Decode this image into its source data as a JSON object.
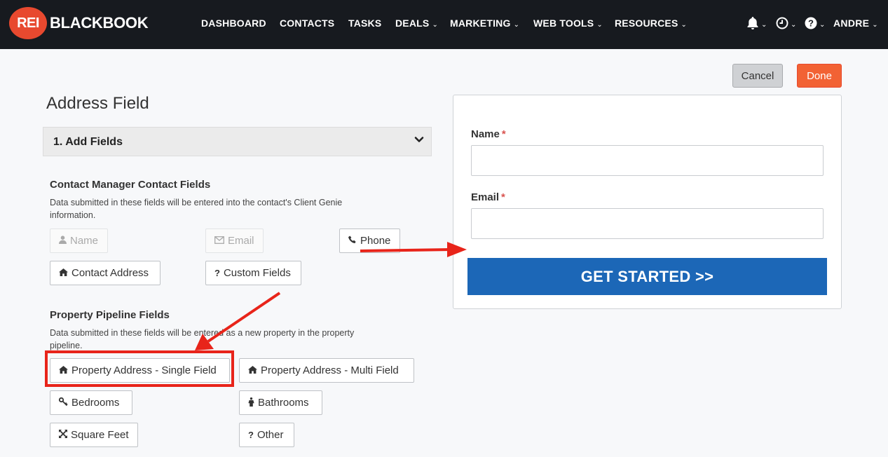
{
  "app": {
    "logo_badge": "REI",
    "logo_text": "BLACKBOOK"
  },
  "nav": {
    "items": [
      {
        "label": "DASHBOARD",
        "has_dropdown": false
      },
      {
        "label": "CONTACTS",
        "has_dropdown": false
      },
      {
        "label": "TASKS",
        "has_dropdown": false
      },
      {
        "label": "DEALS",
        "has_dropdown": true
      },
      {
        "label": "MARKETING",
        "has_dropdown": true
      },
      {
        "label": "WEB TOOLS",
        "has_dropdown": true
      },
      {
        "label": "RESOURCES",
        "has_dropdown": true
      }
    ],
    "icons": [
      "bell-icon",
      "clock-icon",
      "help-icon"
    ],
    "user": "ANDRE"
  },
  "actions": {
    "cancel_label": "Cancel",
    "done_label": "Done"
  },
  "editor": {
    "title": "Address Field",
    "section_label": "1. Add Fields",
    "contact_group": {
      "title": "Contact Manager Contact Fields",
      "description": "Data submitted in these fields will be entered into the contact's Client Genie information.",
      "buttons": [
        {
          "label": "Name",
          "icon": "user-icon",
          "disabled": true
        },
        {
          "label": "Email",
          "icon": "envelope-icon",
          "disabled": true
        },
        {
          "label": "Phone",
          "icon": "phone-icon",
          "disabled": false
        },
        {
          "label": "Contact Address",
          "icon": "home-icon",
          "disabled": false
        },
        {
          "label": "Custom Fields",
          "icon": "question-icon",
          "disabled": false
        }
      ]
    },
    "property_group": {
      "title": "Property Pipeline Fields",
      "description": "Data submitted in these fields will be entered as a new property in the property pipeline.",
      "buttons": [
        {
          "label": "Property Address - Single Field",
          "icon": "home-icon",
          "highlighted": true
        },
        {
          "label": "Property Address - Multi Field",
          "icon": "home-icon"
        },
        {
          "label": "Bedrooms",
          "icon": "key-icon"
        },
        {
          "label": "Bathrooms",
          "icon": "person-icon"
        },
        {
          "label": "Square Feet",
          "icon": "expand-icon"
        },
        {
          "label": "Other",
          "icon": "question-icon"
        }
      ]
    }
  },
  "preview_form": {
    "fields": [
      {
        "label": "Name",
        "required_mark": "*",
        "value": ""
      },
      {
        "label": "Email",
        "required_mark": "*",
        "value": ""
      }
    ],
    "submit_label": "GET STARTED >>"
  },
  "colors": {
    "nav_bg": "#171a1f",
    "brand_orange": "#e8492f",
    "done_button": "#f26234",
    "submit_blue": "#1c67b7",
    "annotation_red": "#e8241a"
  }
}
